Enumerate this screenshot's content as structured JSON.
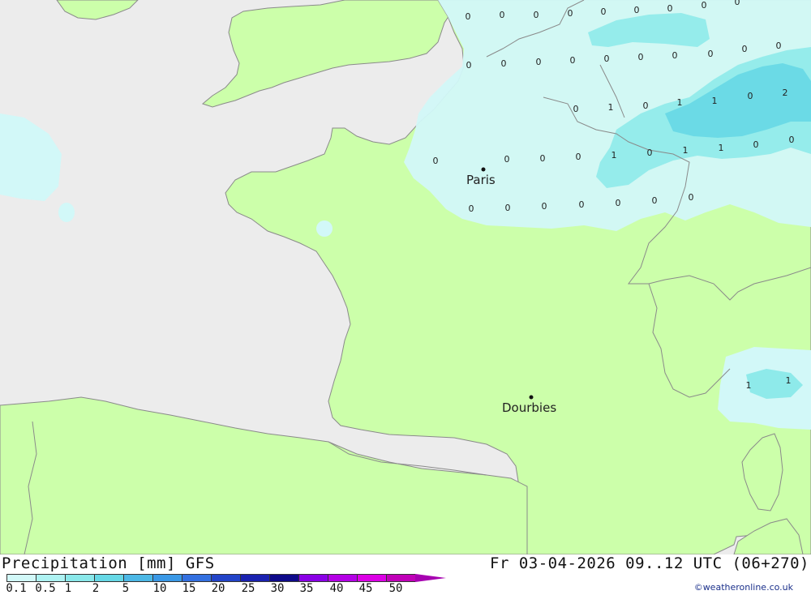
{
  "map": {
    "colors": {
      "sea": "#ececec",
      "land": "#ccff aa",
      "border": "#888888",
      "precip_light": "#d2f8f8",
      "precip_mid": "#8eeaea"
    },
    "cities": [
      {
        "id": "paris",
        "label": "Paris"
      },
      {
        "id": "dourbies",
        "label": "Dourbies"
      }
    ],
    "values": [
      "0",
      "0",
      "0",
      "0",
      "0",
      "0",
      "0",
      "0",
      "0",
      "0",
      "0",
      "0",
      "0",
      "0",
      "0",
      "0",
      "0",
      "0",
      "0",
      "0",
      "1",
      "0",
      "1",
      "1",
      "2",
      "0",
      "0",
      "0",
      "0",
      "0",
      "1",
      "0",
      "1",
      "1",
      "0",
      "0",
      "0",
      "0",
      "0",
      "0",
      "0",
      "0",
      "0",
      "1",
      "1"
    ]
  },
  "footer": {
    "title": "Precipitation [mm] GFS",
    "date": "Fr 03-04-2026 09..12 UTC (06+270)",
    "credit": "©weatheronline.co.uk",
    "legend": {
      "ticks": [
        "0.1",
        "0.5",
        "1",
        "2",
        "5",
        "10",
        "15",
        "20",
        "25",
        "30",
        "35",
        "40",
        "45",
        "50"
      ],
      "colors": [
        "#d2f8f8",
        "#aef2f2",
        "#8ae8ea",
        "#66d8e6",
        "#4cb8e6",
        "#3a98e6",
        "#3370e0",
        "#2244c8",
        "#1a22b0",
        "#0e0a8a",
        "#8a00e6",
        "#b400e6",
        "#dc00e6",
        "#c000b8"
      ]
    }
  }
}
